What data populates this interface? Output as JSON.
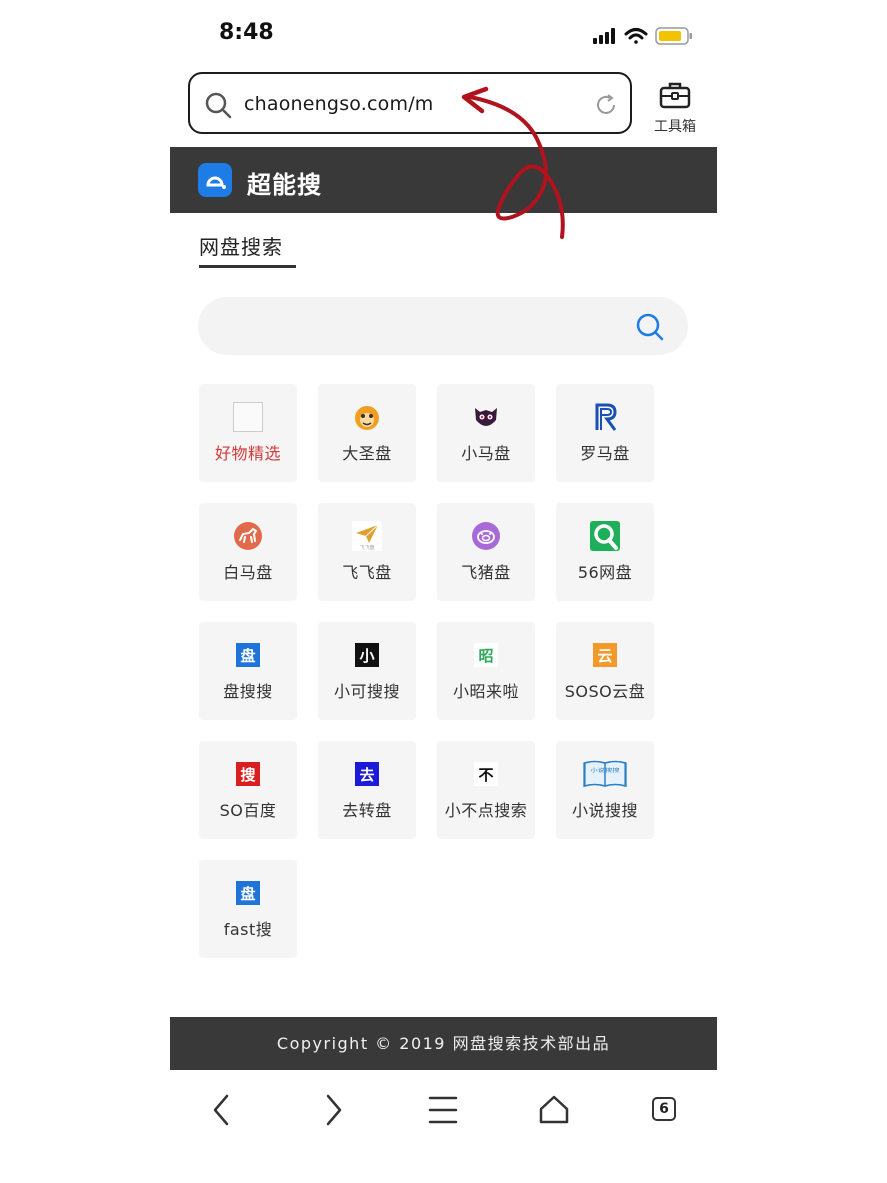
{
  "status_bar": {
    "time": "8:48"
  },
  "address_bar": {
    "url": "chaonengso.com/m"
  },
  "toolbox": {
    "label": "工具箱"
  },
  "site": {
    "title": "超能搜"
  },
  "tabs": [
    {
      "label": "网盘搜索",
      "active": true
    }
  ],
  "search": {
    "placeholder": ""
  },
  "grid": {
    "items": [
      {
        "label": "好物精选",
        "icon": "blank-image-icon",
        "highlight": true
      },
      {
        "label": "大圣盘",
        "icon": "monkey-icon"
      },
      {
        "label": "小马盘",
        "icon": "dark-creature-icon"
      },
      {
        "label": "罗马盘",
        "icon": "r-logo-icon"
      },
      {
        "label": "白马盘",
        "icon": "horse-icon"
      },
      {
        "label": "飞飞盘",
        "icon": "paper-plane-icon"
      },
      {
        "label": "飞猪盘",
        "icon": "pig-icon"
      },
      {
        "label": "56网盘",
        "icon": "magnifier-logo-icon"
      },
      {
        "label": "盘搜搜",
        "icon": "pan-badge-icon",
        "glyph": "盘"
      },
      {
        "label": "小可搜搜",
        "icon": "xiao-badge-icon",
        "glyph": "小"
      },
      {
        "label": "小昭来啦",
        "icon": "zhao-badge-icon",
        "glyph": "昭"
      },
      {
        "label": "SOSO云盘",
        "icon": "yun-badge-icon",
        "glyph": "云"
      },
      {
        "label": "SO百度",
        "icon": "sou-badge-icon",
        "glyph": "搜"
      },
      {
        "label": "去转盘",
        "icon": "qu-badge-icon",
        "glyph": "去"
      },
      {
        "label": "小不点搜索",
        "icon": "bu-badge-icon",
        "glyph": "不"
      },
      {
        "label": "小说搜搜",
        "icon": "book-icon",
        "glyph": "小说搜搜"
      },
      {
        "label": "fast搜",
        "icon": "pan-badge-icon",
        "glyph": "盘"
      }
    ]
  },
  "footer": {
    "text": "Copyright © 2019 网盘搜索技术部出品"
  },
  "bottom_nav": {
    "tab_count": "6"
  },
  "colors": {
    "header_bg": "#393939",
    "brand_blue": "#1e7ce6",
    "highlight_red": "#d33a3a",
    "annotation_red": "#b0121e"
  }
}
